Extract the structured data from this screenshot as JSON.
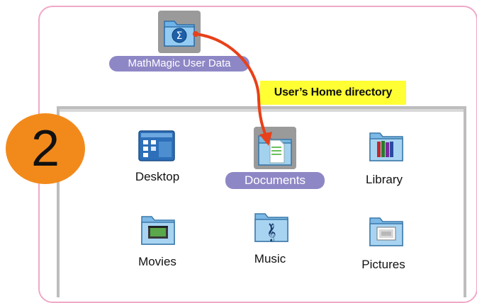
{
  "desktop": {
    "file_icon": {
      "label": "MathMagic User Data",
      "icon": "sigma-folder-icon"
    }
  },
  "callout": {
    "text": "User’s Home directory"
  },
  "step": {
    "number": "2"
  },
  "finder": {
    "items": [
      {
        "label": "Desktop",
        "icon": "desktop-folder-icon",
        "selected": false
      },
      {
        "label": "Documents",
        "icon": "documents-folder-icon",
        "selected": true
      },
      {
        "label": "Library",
        "icon": "library-folder-icon",
        "selected": false
      },
      {
        "label": "Movies",
        "icon": "movies-folder-icon",
        "selected": false
      },
      {
        "label": "Music",
        "icon": "music-folder-icon",
        "selected": false
      },
      {
        "label": "Pictures",
        "icon": "pictures-folder-icon",
        "selected": false
      }
    ]
  },
  "colors": {
    "frame_border": "#f0a8c8",
    "selection_pill": "#8e87c6",
    "callout_bg": "#ffff33",
    "step_badge": "#f28a1b",
    "arrow": "#e8401a"
  }
}
